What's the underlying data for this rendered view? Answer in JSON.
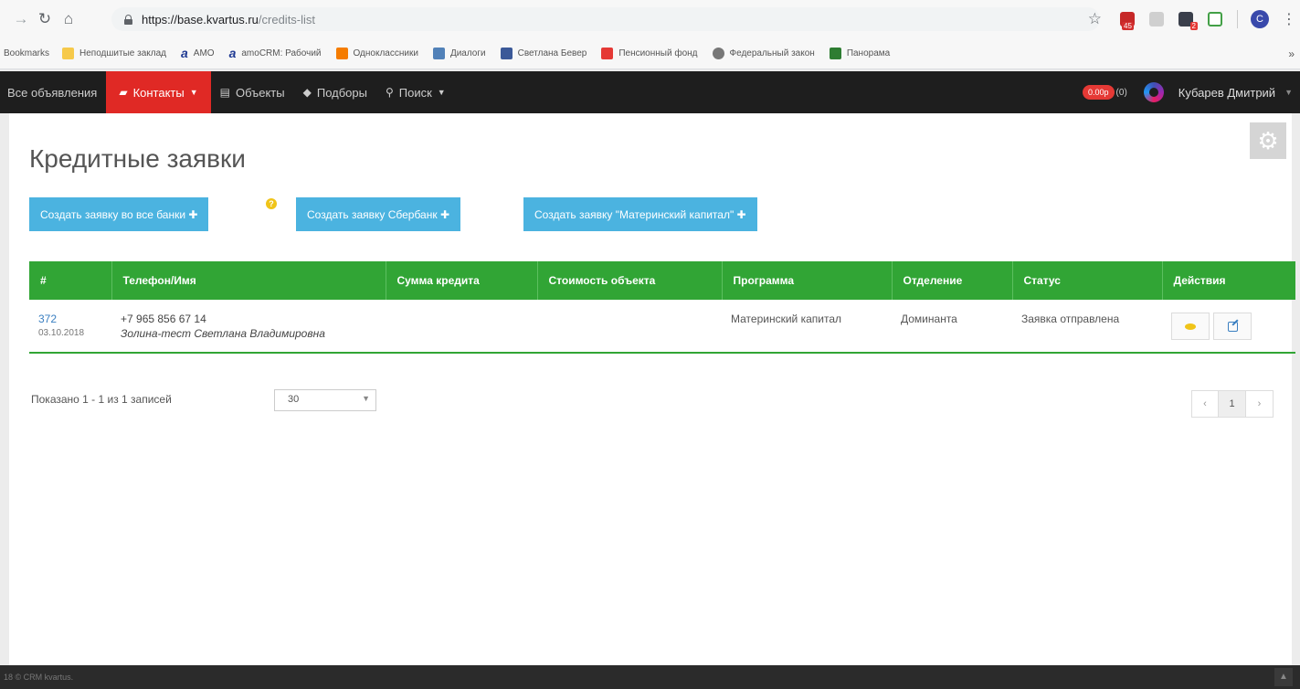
{
  "browser": {
    "url_host": "https://base.kvartus.ru",
    "url_path": "/credits-list",
    "ext_red_badge": "45",
    "ext_dark_badge": "2",
    "profile_initial": "C",
    "bookmarks": [
      "Bookmarks",
      "Неподшитые заклад",
      "AMO",
      "amoCRM: Рабочий",
      "Одноклассники",
      "Диалоги",
      "Светлана Бевер",
      "Пенсионный фонд",
      "Федеральный закон",
      "Панорама"
    ],
    "more": "»"
  },
  "nav": {
    "all_ads": "Все объявления",
    "contacts": "Контакты",
    "objects": "Объекты",
    "selections": "Подборы",
    "search": "Поиск",
    "balance": "0.00р",
    "counter": "(0)",
    "user": "Кубарев Дмитрий"
  },
  "page": {
    "title": "Кредитные заявки",
    "btn_all_banks": "Создать заявку во все банки ✚",
    "btn_sber": "Создать заявку Сбербанк ✚",
    "btn_matcap": "Создать заявку \"Материнский капитал\" ✚",
    "help": "?"
  },
  "table": {
    "headers": [
      "#",
      "Телефон/Имя",
      "Сумма кредита",
      "Стоимость объекта",
      "Программа",
      "Отделение",
      "Статус",
      "Действия"
    ],
    "rows": [
      {
        "id": "372",
        "date": "03.10.2018",
        "phone": "+7 965 856 67 14",
        "name": "Золина-тест Светлана Владимировна",
        "amount": "",
        "object_cost": "",
        "program": "Материнский капитал",
        "branch": "Доминанта",
        "status": "Заявка отправлена"
      }
    ]
  },
  "pagination": {
    "shown": "Показано 1 - 1 из 1 записей",
    "per_page": "30",
    "prev": "‹",
    "current": "1",
    "next": "›"
  },
  "footer": {
    "text": "18 © CRM kvartus."
  }
}
